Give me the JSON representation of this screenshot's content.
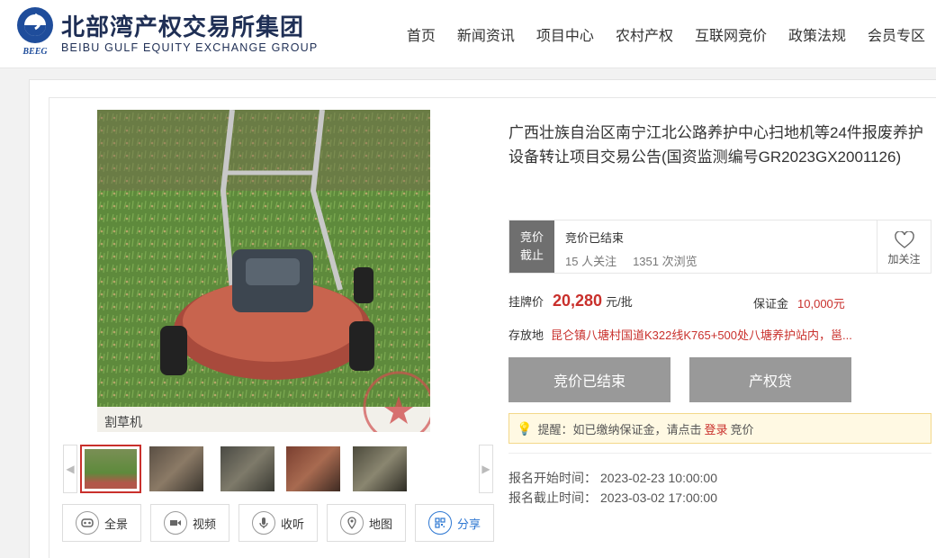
{
  "header": {
    "logo_cn": "北部湾产权交易所集团",
    "logo_en": "BEIBU GULF EQUITY EXCHANGE GROUP",
    "logo_mark": "BEEG",
    "nav": [
      "首页",
      "新闻资讯",
      "项目中心",
      "农村产权",
      "互联网竞价",
      "政策法规",
      "会员专区"
    ]
  },
  "gallery": {
    "photo_caption": "割草机",
    "thumbnail_count": 5,
    "active_thumbnail": 1
  },
  "media_buttons": [
    {
      "label": "全景",
      "icon": "vr-icon"
    },
    {
      "label": "视频",
      "icon": "video-icon"
    },
    {
      "label": "收听",
      "icon": "microphone-icon"
    },
    {
      "label": "地图",
      "icon": "map-pin-icon"
    },
    {
      "label": "分享",
      "icon": "qrcode-icon"
    }
  ],
  "project": {
    "title": "广西壮族自治区南宁江北公路养护中心扫地机等24件报废养护设备转让项目交易公告(国资监测编号GR2023GX2001126)",
    "status_label_1": "竞价",
    "status_label_2": "截止",
    "status_text": "竞价已结束",
    "followers": "15 人关注",
    "views": "1351 次浏览",
    "follow_label": "加关注",
    "price_label": "挂牌价",
    "price": "20,280",
    "price_unit": "元/批",
    "deposit_label": "保证金",
    "deposit": "10,000元",
    "location_label": "存放地",
    "location": "昆仑镇八塘村国道K322线K765+500处八塘养护站内，邕...",
    "btn_ended": "竞价已结束",
    "btn_loan": "产权贷",
    "reminder_prefix": "提醒：如已缴纳保证金，请点击",
    "reminder_login": "登录",
    "reminder_suffix": "竞价",
    "signup_start_label": "报名开始时间：",
    "signup_start": "2023-02-23 10:00:00",
    "signup_end_label": "报名截止时间：",
    "signup_end": "2023-03-02 17:00:00"
  },
  "colors": {
    "accent_red": "#c9302c",
    "brand_navy": "#1f2f55",
    "link_blue": "#2d77d2"
  }
}
